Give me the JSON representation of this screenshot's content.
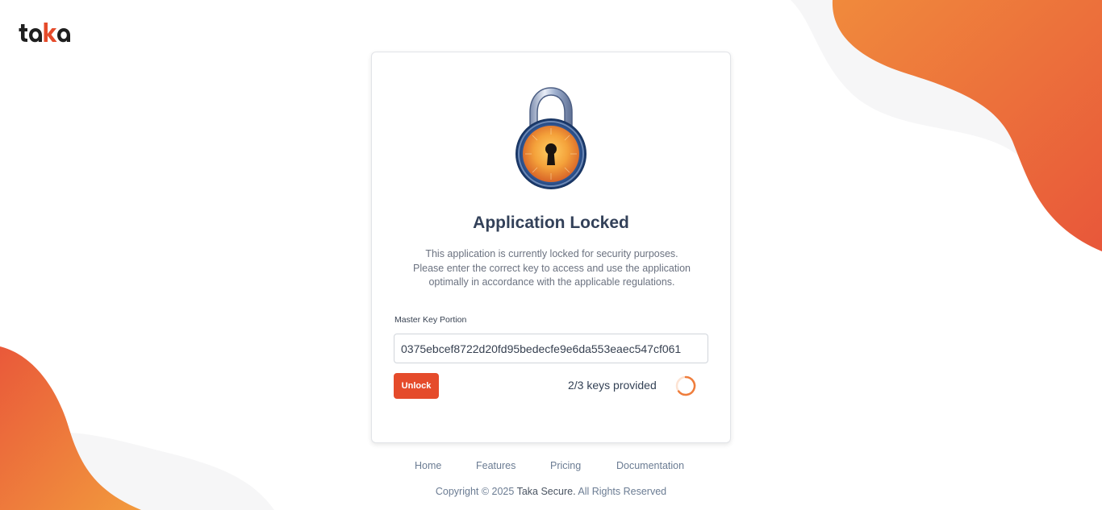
{
  "brand": {
    "logo_text": "taka",
    "accent_color": "#e54b2b",
    "gradient_colors": [
      "#f29a3d",
      "#e8573a"
    ]
  },
  "lock_card": {
    "icon": "padlock-icon",
    "title": "Application Locked",
    "description_lines": [
      "This application is currently locked for security purposes.",
      "Please enter the correct key to access and use the application",
      "optimally in accordance with the applicable regulations."
    ],
    "field_label": "Master Key Portion",
    "key_value": "0375ebcef8722d20fd95bedecfe9e6da553eaec547cf061",
    "unlock_label": "Unlock",
    "keys_status": "2/3 keys provided",
    "keys_provided": 2,
    "keys_total": 3,
    "loading_icon": "spinner-icon"
  },
  "footer": {
    "nav": [
      "Home",
      "Features",
      "Pricing",
      "Documentation"
    ],
    "copyright_prefix": "Copyright © 2025",
    "copyright_brand": "Taka Secure.",
    "copyright_suffix": "All Rights Reserved"
  }
}
